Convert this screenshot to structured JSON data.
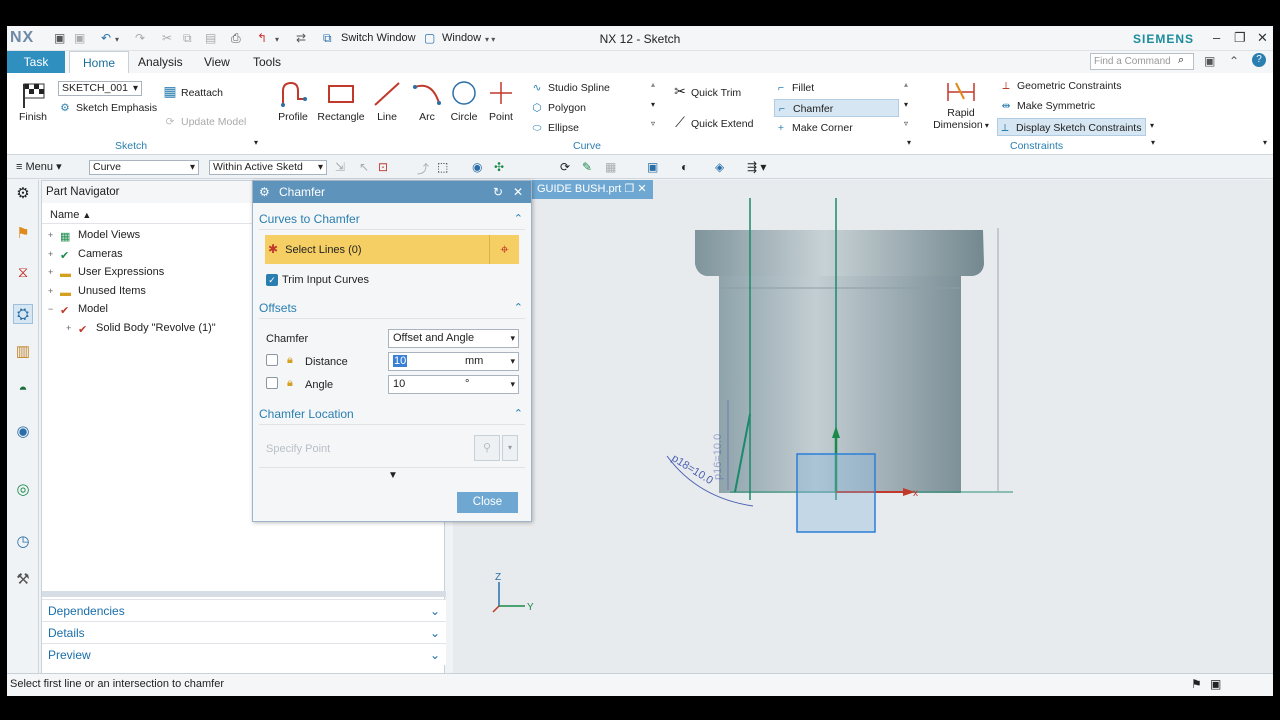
{
  "titlebar": {
    "logo": "NX",
    "title": "NX 12 - Sketch",
    "brand": "SIEMENS",
    "switch_window": "Switch Window",
    "window_menu": "Window"
  },
  "tabs": {
    "task": "Task",
    "home": "Home",
    "analysis": "Analysis",
    "view": "View",
    "tools": "Tools",
    "find_placeholder": "Find a Command"
  },
  "ribbon": {
    "sketch_name": "SKETCH_001",
    "finish": "Finish",
    "sketch_emphasis": "Sketch Emphasis",
    "reattach": "Reattach",
    "update_model": "Update Model",
    "group_sketch": "Sketch",
    "profile": "Profile",
    "rectangle": "Rectangle",
    "line": "Line",
    "arc": "Arc",
    "circle": "Circle",
    "point": "Point",
    "studio_spline": "Studio Spline",
    "polygon": "Polygon",
    "ellipse": "Ellipse",
    "group_curve": "Curve",
    "quick_trim": "Quick Trim",
    "quick_extend": "Quick Extend",
    "fillet": "Fillet",
    "chamfer": "Chamfer",
    "make_corner": "Make Corner",
    "rapid_dimension_1": "Rapid",
    "rapid_dimension_2": "Dimension",
    "geometric_constraints": "Geometric Constraints",
    "make_symmetric": "Make Symmetric",
    "display_sketch_constraints": "Display Sketch Constraints",
    "group_constraints": "Constraints"
  },
  "toolbar2": {
    "menu": "Menu",
    "filter": "Curve",
    "scope": "Within Active Sketd"
  },
  "navigator": {
    "title": "Part Navigator",
    "column_name": "Name",
    "items": [
      {
        "label": "Model Views"
      },
      {
        "label": "Cameras"
      },
      {
        "label": "User Expressions"
      },
      {
        "label": "Unused Items"
      },
      {
        "label": "Model"
      },
      {
        "label": "Solid Body \"Revolve (1)\""
      }
    ],
    "dependencies": "Dependencies",
    "details": "Details",
    "preview": "Preview"
  },
  "dialog": {
    "title": "Chamfer",
    "sec_curves": "Curves to Chamfer",
    "select_lines": "Select Lines (0)",
    "trim_input": "Trim Input Curves",
    "sec_offsets": "Offsets",
    "chamfer_label": "Chamfer",
    "chamfer_type": "Offset and Angle",
    "distance_label": "Distance",
    "distance_value": "10",
    "distance_unit": "mm",
    "angle_label": "Angle",
    "angle_value": "10",
    "angle_unit": "°",
    "sec_location": "Chamfer Location",
    "specify_point": "Specify Point",
    "close": "Close"
  },
  "viewport": {
    "file_tab": "GUIDE BUSH.prt",
    "dim_text": "p18=10.0",
    "dim_vertical": "p16=10.0"
  },
  "status": {
    "message": "Select first line or an intersection to chamfer"
  }
}
